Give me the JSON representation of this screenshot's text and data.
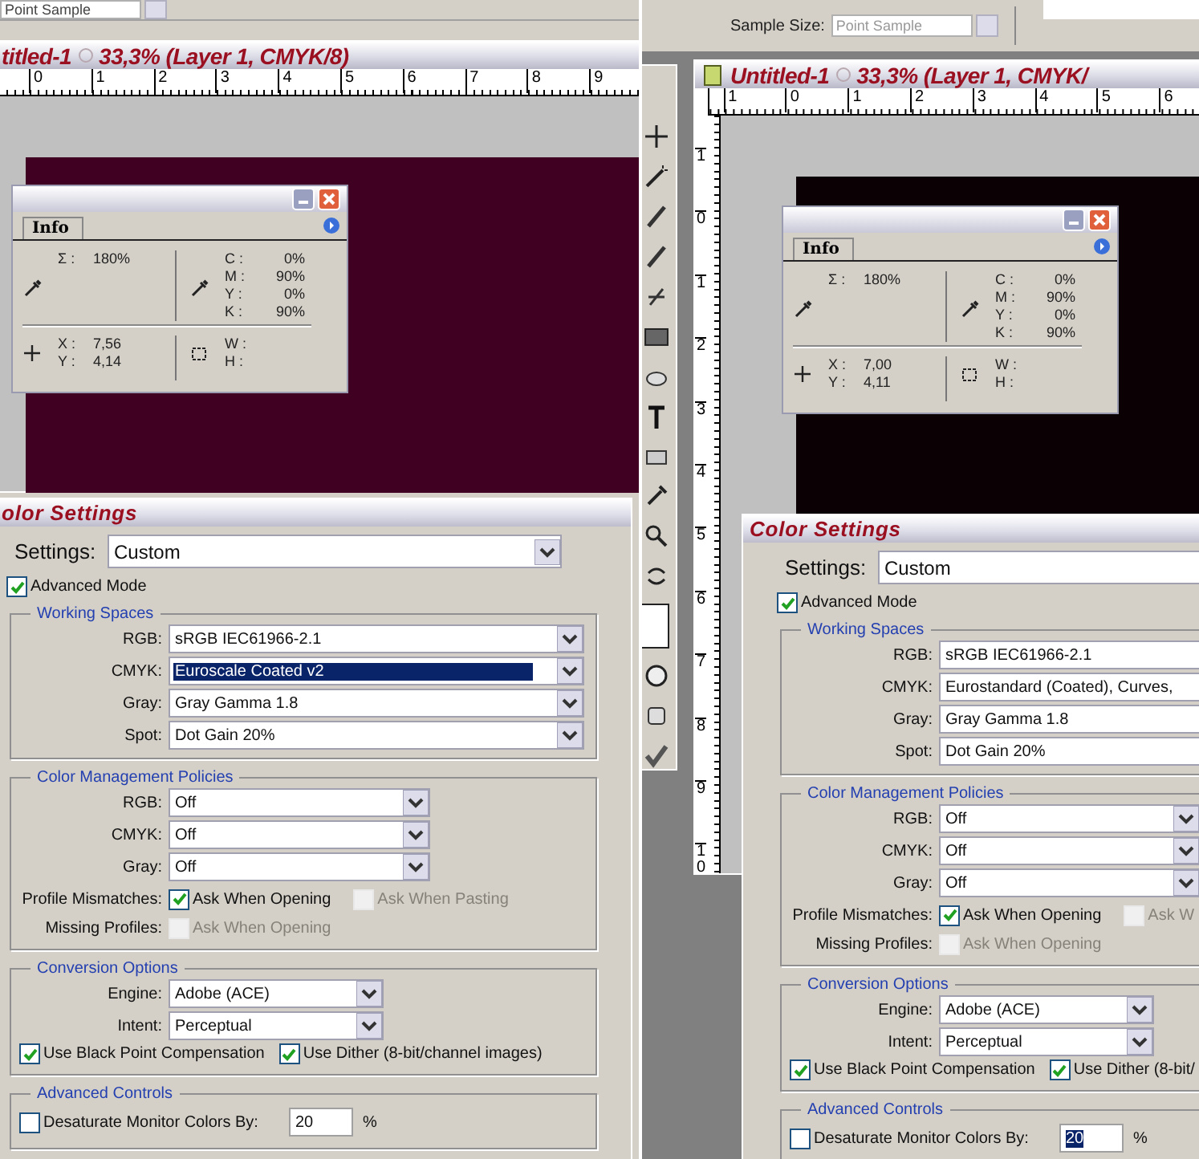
{
  "left_screen": {
    "options_bar": {
      "sample_field": "Point Sample"
    },
    "document": {
      "title_name": "titled-1",
      "title_info": "33,3% (Layer 1, CMYK/8)",
      "ruler_numbers": [
        "0",
        "1",
        "2",
        "3",
        "4",
        "5",
        "6",
        "7",
        "8",
        "9"
      ]
    },
    "info_panel": {
      "tab": "Info",
      "total": {
        "label": "Σ :",
        "value": "180%"
      },
      "channels": [
        {
          "label": "C :",
          "value": "0%"
        },
        {
          "label": "M :",
          "value": "90%"
        },
        {
          "label": "Y :",
          "value": "0%"
        },
        {
          "label": "K :",
          "value": "90%"
        }
      ],
      "position": [
        {
          "label": "X :",
          "value": "7,56"
        },
        {
          "label": "Y :",
          "value": "4,14"
        }
      ],
      "size": [
        {
          "label": "W :"
        },
        {
          "label": "H :"
        }
      ]
    },
    "color_settings": {
      "title": "olor Settings",
      "settings": {
        "label": "Settings:",
        "value": "Custom"
      },
      "advanced_mode": {
        "label": "Advanced Mode",
        "checked": true
      },
      "working_spaces": {
        "title": "Working Spaces",
        "rows": [
          {
            "label": "RGB:",
            "value": "sRGB IEC61966-2.1",
            "highlighted": false
          },
          {
            "label": "CMYK:",
            "value": "Euroscale Coated v2",
            "highlighted": true
          },
          {
            "label": "Gray:",
            "value": "Gray Gamma 1.8",
            "highlighted": false
          },
          {
            "label": "Spot:",
            "value": "Dot Gain 20%",
            "highlighted": false
          }
        ]
      },
      "policies": {
        "title": "Color Management Policies",
        "rows": [
          {
            "label": "RGB:",
            "value": "Off"
          },
          {
            "label": "CMYK:",
            "value": "Off"
          },
          {
            "label": "Gray:",
            "value": "Off"
          }
        ],
        "profile_mismatches": {
          "label": "Profile Mismatches:",
          "options": [
            {
              "label": "Ask When Opening",
              "checked": true,
              "disabled": false
            },
            {
              "label": "Ask When Pasting",
              "checked": false,
              "disabled": true
            }
          ]
        },
        "missing_profiles": {
          "label": "Missing Profiles:",
          "options": [
            {
              "label": "Ask When Opening",
              "checked": false,
              "disabled": true
            }
          ]
        }
      },
      "conversion": {
        "title": "Conversion Options",
        "rows": [
          {
            "label": "Engine:",
            "value": "Adobe (ACE)"
          },
          {
            "label": "Intent:",
            "value": "Perceptual"
          }
        ],
        "options": [
          {
            "label": "Use Black Point Compensation",
            "checked": true,
            "disabled": false
          },
          {
            "label": "Use Dither (8-bit/channel images)",
            "checked": true,
            "disabled": false
          }
        ]
      },
      "advanced_controls": {
        "title": "Advanced Controls",
        "desaturate": {
          "label": "Desaturate Monitor Colors By:",
          "checked": false,
          "value": "20",
          "unit": "%",
          "highlighted": false
        }
      }
    }
  },
  "right_screen": {
    "options_bar": {
      "sample_label": "Sample Size:",
      "sample_field": "Point Sample"
    },
    "document": {
      "title_name": "Untitled-1",
      "title_info": "33,3% (Layer 1, CMYK/",
      "ruler_numbers": [
        "1",
        "0",
        "1",
        "2",
        "3",
        "4",
        "5",
        "6"
      ],
      "vertical_ruler_numbers": [
        "1",
        "0",
        "1",
        "2",
        "3",
        "4",
        "5",
        "6",
        "7",
        "8",
        "9",
        "10"
      ]
    },
    "info_panel": {
      "tab": "Info",
      "total": {
        "label": "Σ :",
        "value": "180%"
      },
      "channels": [
        {
          "label": "C :",
          "value": "0%"
        },
        {
          "label": "M :",
          "value": "90%"
        },
        {
          "label": "Y :",
          "value": "0%"
        },
        {
          "label": "K :",
          "value": "90%"
        }
      ],
      "position": [
        {
          "label": "X :",
          "value": "7,00"
        },
        {
          "label": "Y :",
          "value": "4,11"
        }
      ],
      "size": [
        {
          "label": "W :"
        },
        {
          "label": "H :"
        }
      ]
    },
    "color_settings": {
      "title": "Color Settings",
      "settings": {
        "label": "Settings:",
        "value": "Custom"
      },
      "advanced_mode": {
        "label": "Advanced Mode",
        "checked": true
      },
      "working_spaces": {
        "title": "Working Spaces",
        "rows": [
          {
            "label": "RGB:",
            "value": "sRGB IEC61966-2.1",
            "highlighted": false
          },
          {
            "label": "CMYK:",
            "value": "Eurostandard (Coated), Curves,",
            "highlighted": false
          },
          {
            "label": "Gray:",
            "value": "Gray Gamma 1.8",
            "highlighted": false
          },
          {
            "label": "Spot:",
            "value": "Dot Gain 20%",
            "highlighted": false
          }
        ]
      },
      "policies": {
        "title": "Color Management Policies",
        "rows": [
          {
            "label": "RGB:",
            "value": "Off"
          },
          {
            "label": "CMYK:",
            "value": "Off"
          },
          {
            "label": "Gray:",
            "value": "Off"
          }
        ],
        "profile_mismatches": {
          "label": "Profile Mismatches:",
          "options": [
            {
              "label": "Ask When Opening",
              "checked": true,
              "disabled": false
            },
            {
              "label": "Ask W",
              "checked": false,
              "disabled": true
            }
          ]
        },
        "missing_profiles": {
          "label": "Missing Profiles:",
          "options": [
            {
              "label": "Ask When Opening",
              "checked": false,
              "disabled": true
            }
          ]
        }
      },
      "conversion": {
        "title": "Conversion Options",
        "rows": [
          {
            "label": "Engine:",
            "value": "Adobe (ACE)"
          },
          {
            "label": "Intent:",
            "value": "Perceptual"
          }
        ],
        "options": [
          {
            "label": "Use Black Point Compensation",
            "checked": true,
            "disabled": false
          },
          {
            "label": "Use Dither (8-bit/",
            "checked": true,
            "disabled": false
          }
        ]
      },
      "advanced_controls": {
        "title": "Advanced Controls",
        "desaturate": {
          "label": "Desaturate Monitor Colors By:",
          "checked": false,
          "value": "20",
          "unit": "%",
          "highlighted": true
        }
      }
    }
  }
}
